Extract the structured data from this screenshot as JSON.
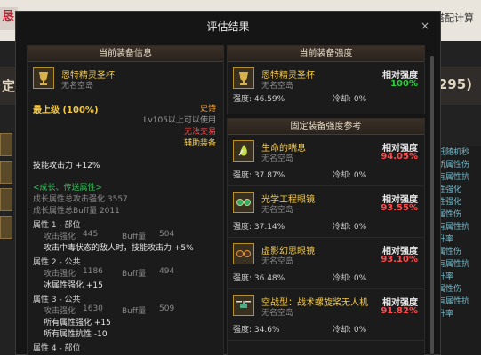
{
  "background": {
    "left_title": "定",
    "left_top_char": "恳",
    "right_top_text": "搭配计算",
    "points": "295)",
    "right_col": [
      "低随机秒",
      "新属性伤",
      "有属性抗",
      "性强化",
      "性强化",
      "属性伤",
      "有属性抗",
      "升率",
      "属性伤",
      "有属性抗",
      "升率",
      "属性伤",
      "有属性抗",
      "升率"
    ]
  },
  "modal": {
    "title": "评估结果",
    "close": "×"
  },
  "left_panel": {
    "header": "当前装备信息",
    "item": {
      "name": "恩特精灵圣杯",
      "source": "无名空岛"
    },
    "level": "最上级 (100%)",
    "rarity": "史诗",
    "requirement": "Lv105以上可以使用",
    "trade": "无法交易",
    "slot": "辅助装备",
    "attack_bonus": "技能攻击力  +12%",
    "growth_title": "<成长、传送属性>",
    "growth_attack": "成长属性总攻击强化 3557",
    "growth_buff": "成长属性总Buff量 2011",
    "props": [
      {
        "title": "属性 1 - 部位",
        "atk_label": "攻击强化",
        "atk": "445",
        "buff_label": "Buff量",
        "buff": "504",
        "lines": [
          "攻击中毒状态的敌人时，技能攻击力 +5%"
        ]
      },
      {
        "title": "属性 2 - 公共",
        "atk_label": "攻击强化",
        "atk": "1186",
        "buff_label": "Buff量",
        "buff": "494",
        "lines": [
          "冰属性强化 +15"
        ]
      },
      {
        "title": "属性 3 - 公共",
        "atk_label": "攻击强化",
        "atk": "1630",
        "buff_label": "Buff量",
        "buff": "509",
        "lines": [
          "所有属性强化 +15",
          "所有属性抗性 -10"
        ]
      },
      {
        "title": "属性 4 - 部位",
        "atk_label": "",
        "atk": "",
        "buff_label": "",
        "buff": "",
        "lines": []
      }
    ]
  },
  "right_top": {
    "header": "当前装备强度",
    "item": {
      "name": "恩特精灵圣杯",
      "source": "无名空岛"
    },
    "rel_label": "相对强度",
    "rel_value": "100%",
    "strength": "强度: 46.59%",
    "cooldown": "冷却: 0%"
  },
  "right_ref": {
    "header": "固定装备强度参考",
    "items": [
      {
        "name": "生命的喘息",
        "source": "无名空岛",
        "rel_label": "相对强度",
        "rel_value": "94.05%",
        "strength": "强度: 37.87%",
        "cooldown": "冷却: 0%",
        "icon": "green-fire-icon"
      },
      {
        "name": "光学工程眼镜",
        "source": "无名空岛",
        "rel_label": "相对强度",
        "rel_value": "93.55%",
        "strength": "强度: 37.14%",
        "cooldown": "冷却: 0%",
        "icon": "goggles-icon"
      },
      {
        "name": "虚影幻思眼镜",
        "source": "无名空岛",
        "rel_label": "相对强度",
        "rel_value": "93.10%",
        "strength": "强度: 36.48%",
        "cooldown": "冷却: 0%",
        "icon": "dark-goggles-icon"
      },
      {
        "name": "空战型：战术螺旋桨无人机",
        "source": "无名空岛",
        "rel_label": "相对强度",
        "rel_value": "91.82%",
        "strength": "强度: 34.6%",
        "cooldown": "冷却: 0%",
        "icon": "drone-icon"
      }
    ]
  },
  "colors": {
    "gold": "#f2c94c",
    "green": "#2ecc40",
    "red": "#ff4d4d",
    "orange": "#f0a030",
    "growth_green": "#3fbf5f"
  }
}
